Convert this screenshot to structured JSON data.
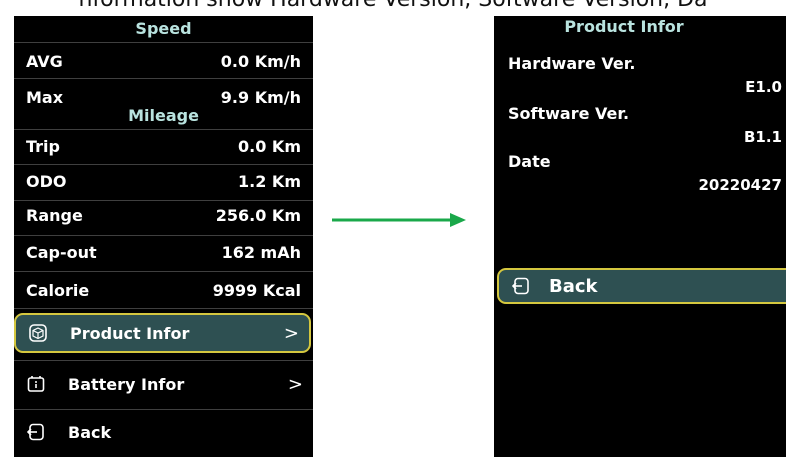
{
  "caption": "nformation show Hardware Version, Software Version, Da",
  "left_screen": {
    "speed_heading": "Speed",
    "speed_rows": [
      {
        "label": "AVG",
        "value": "0.0  Km/h"
      },
      {
        "label": "Max",
        "value": "9.9  Km/h"
      }
    ],
    "mileage_heading": "Mileage",
    "mileage_rows": [
      {
        "label": "Trip",
        "value": "0.0  Km"
      },
      {
        "label": "ODO",
        "value": "1.2  Km"
      },
      {
        "label": "Range",
        "value": "256.0  Km"
      },
      {
        "label": "Cap-out",
        "value": "162  mAh"
      },
      {
        "label": "Calorie",
        "value": "9999  Kcal"
      }
    ],
    "menu": [
      {
        "label": "Product Infor",
        "arrow": ">",
        "icon": "cube-icon",
        "selected": true
      },
      {
        "label": "Battery Infor",
        "arrow": ">",
        "icon": "info-box-icon",
        "selected": false
      },
      {
        "label": "Back",
        "arrow": "",
        "icon": "exit-icon",
        "selected": false
      }
    ]
  },
  "right_screen": {
    "title": "Product Infor",
    "hardware_label": "Hardware Ver.",
    "hardware_value": "E1.0",
    "software_label": "Software Ver.",
    "software_value": "B1.1",
    "date_label": "Date",
    "date_value": "20220427",
    "back_label": "Back"
  },
  "colors": {
    "screen_bg": "#000000",
    "heading": "#b9e3df",
    "selected_bg": "#2e5052",
    "selected_border": "#d4c73f",
    "arrow": "#1aa84a"
  }
}
